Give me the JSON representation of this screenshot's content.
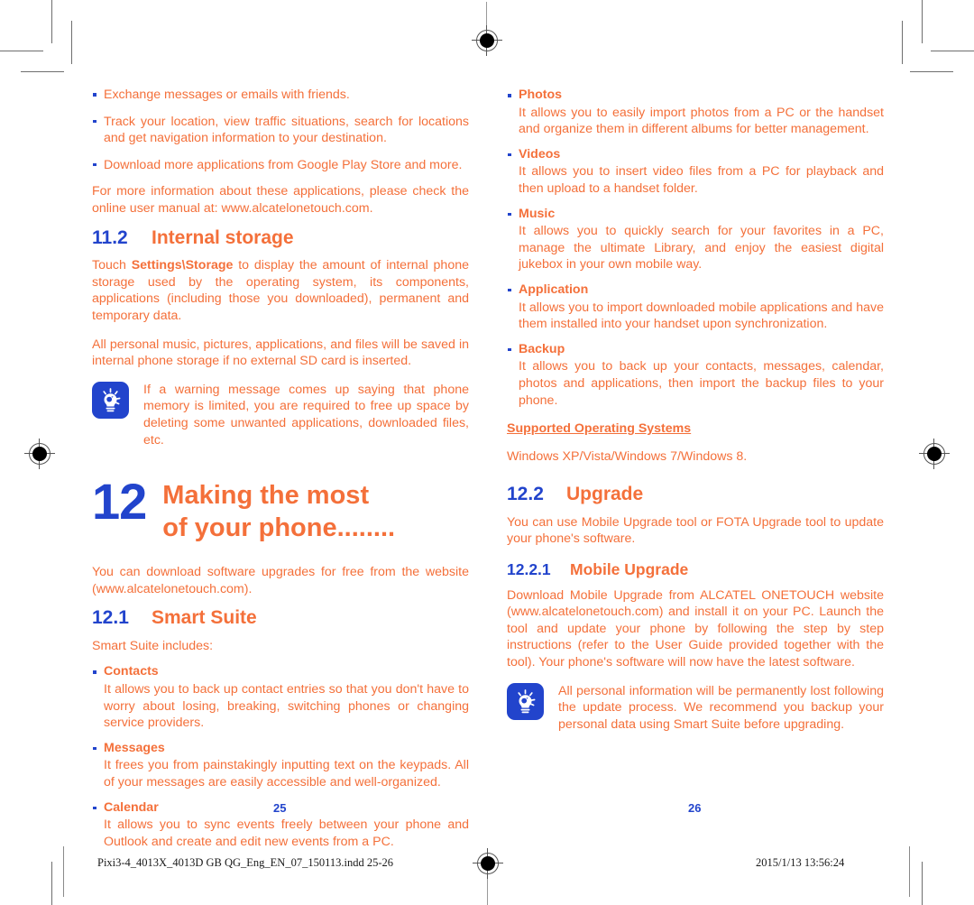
{
  "document": {
    "left_page": {
      "folio": "25",
      "intro_bullets": [
        "Exchange messages or emails with friends.",
        "Track your location, view traffic situations, search for locations and get navigation information to your destination.",
        "Download more applications from Google Play Store and more."
      ],
      "intro_paragraph": "For more information about these applications, please check the online user manual at: www.alcatelonetouch.com.",
      "internal_storage": {
        "number": "11.2",
        "title": "Internal storage",
        "paragraph_1_prefix": "Touch ",
        "paragraph_1_bold": "Settings\\Storage",
        "paragraph_1_suffix": " to display the amount of internal phone storage used by the operating system, its components, applications (including those you downloaded), permanent and temporary data.",
        "paragraph_2": "All personal music, pictures, applications, and files will be saved in internal phone storage if no external SD card is inserted.",
        "tip": "If a warning message comes up saying that phone memory is limited, you are required to free up space by deleting some unwanted applications, downloaded files, etc."
      },
      "chapter": {
        "number": "12",
        "title_line_1": "Making the most",
        "title_line_2": "of your phone........"
      },
      "chapter_intro": "You can download software upgrades for free from the website (www.alcatelonetouch.com).",
      "smart_suite": {
        "number": "12.1",
        "title": "Smart Suite",
        "lead": "Smart Suite includes:",
        "features": [
          {
            "term": "Contacts",
            "desc": "It allows you to back up contact entries so that you don't have to worry about losing, breaking, switching phones or changing service providers."
          },
          {
            "term": "Messages",
            "desc": "It frees you from painstakingly inputting text on the keypads. All of your messages are easily accessible and well-organized."
          },
          {
            "term": "Calendar",
            "desc": "It allows you to sync events freely between your phone and Outlook and create and edit new events from a PC."
          }
        ]
      }
    },
    "right_page": {
      "folio": "26",
      "features": [
        {
          "term": "Photos",
          "desc": "It allows you to easily import photos from a PC or the handset and organize them in different albums for better management."
        },
        {
          "term": "Videos",
          "desc": "It allows you to insert video files from a PC for playback and then upload to a handset folder."
        },
        {
          "term": "Music",
          "desc": "It allows you to quickly search for your favorites in a PC, manage the ultimate Library, and enjoy the easiest digital jukebox in your own mobile way."
        },
        {
          "term": "Application",
          "desc": "It allows you to import downloaded mobile applications and have them installed into your handset upon synchronization."
        },
        {
          "term": "Backup",
          "desc": "It allows you to back up your contacts, messages, calendar, photos and applications, then import the backup files to your phone."
        }
      ],
      "supported_os_label": "Supported Operating Systems",
      "supported_os_value": "Windows XP/Vista/Windows 7/Windows 8.",
      "upgrade": {
        "number": "12.2",
        "title": "Upgrade",
        "paragraph": "You can use Mobile Upgrade tool or FOTA Upgrade tool to  update your phone's software."
      },
      "mobile_upgrade": {
        "number": "12.2.1",
        "title": "Mobile Upgrade",
        "paragraph": "Download Mobile Upgrade from ALCATEL ONETOUCH website (www.alcatelonetouch.com) and install it on your PC. Launch the tool and update your phone by following the step by step instructions (refer to the User Guide provided together with the tool). Your phone's software will now have the latest software.",
        "tip": "All personal information will be permanently lost following the update process. We recommend you backup your personal data using Smart Suite before upgrading."
      }
    },
    "footer": {
      "filename": "Pixi3-4_4013X_4013D GB QG_Eng_EN_07_150113.indd   25-26",
      "timestamp": "2015/1/13   13:56:24"
    },
    "colors": {
      "orange": "#f4703a",
      "blue": "#2244cc",
      "mark_gray": "#6e6e6e"
    }
  }
}
